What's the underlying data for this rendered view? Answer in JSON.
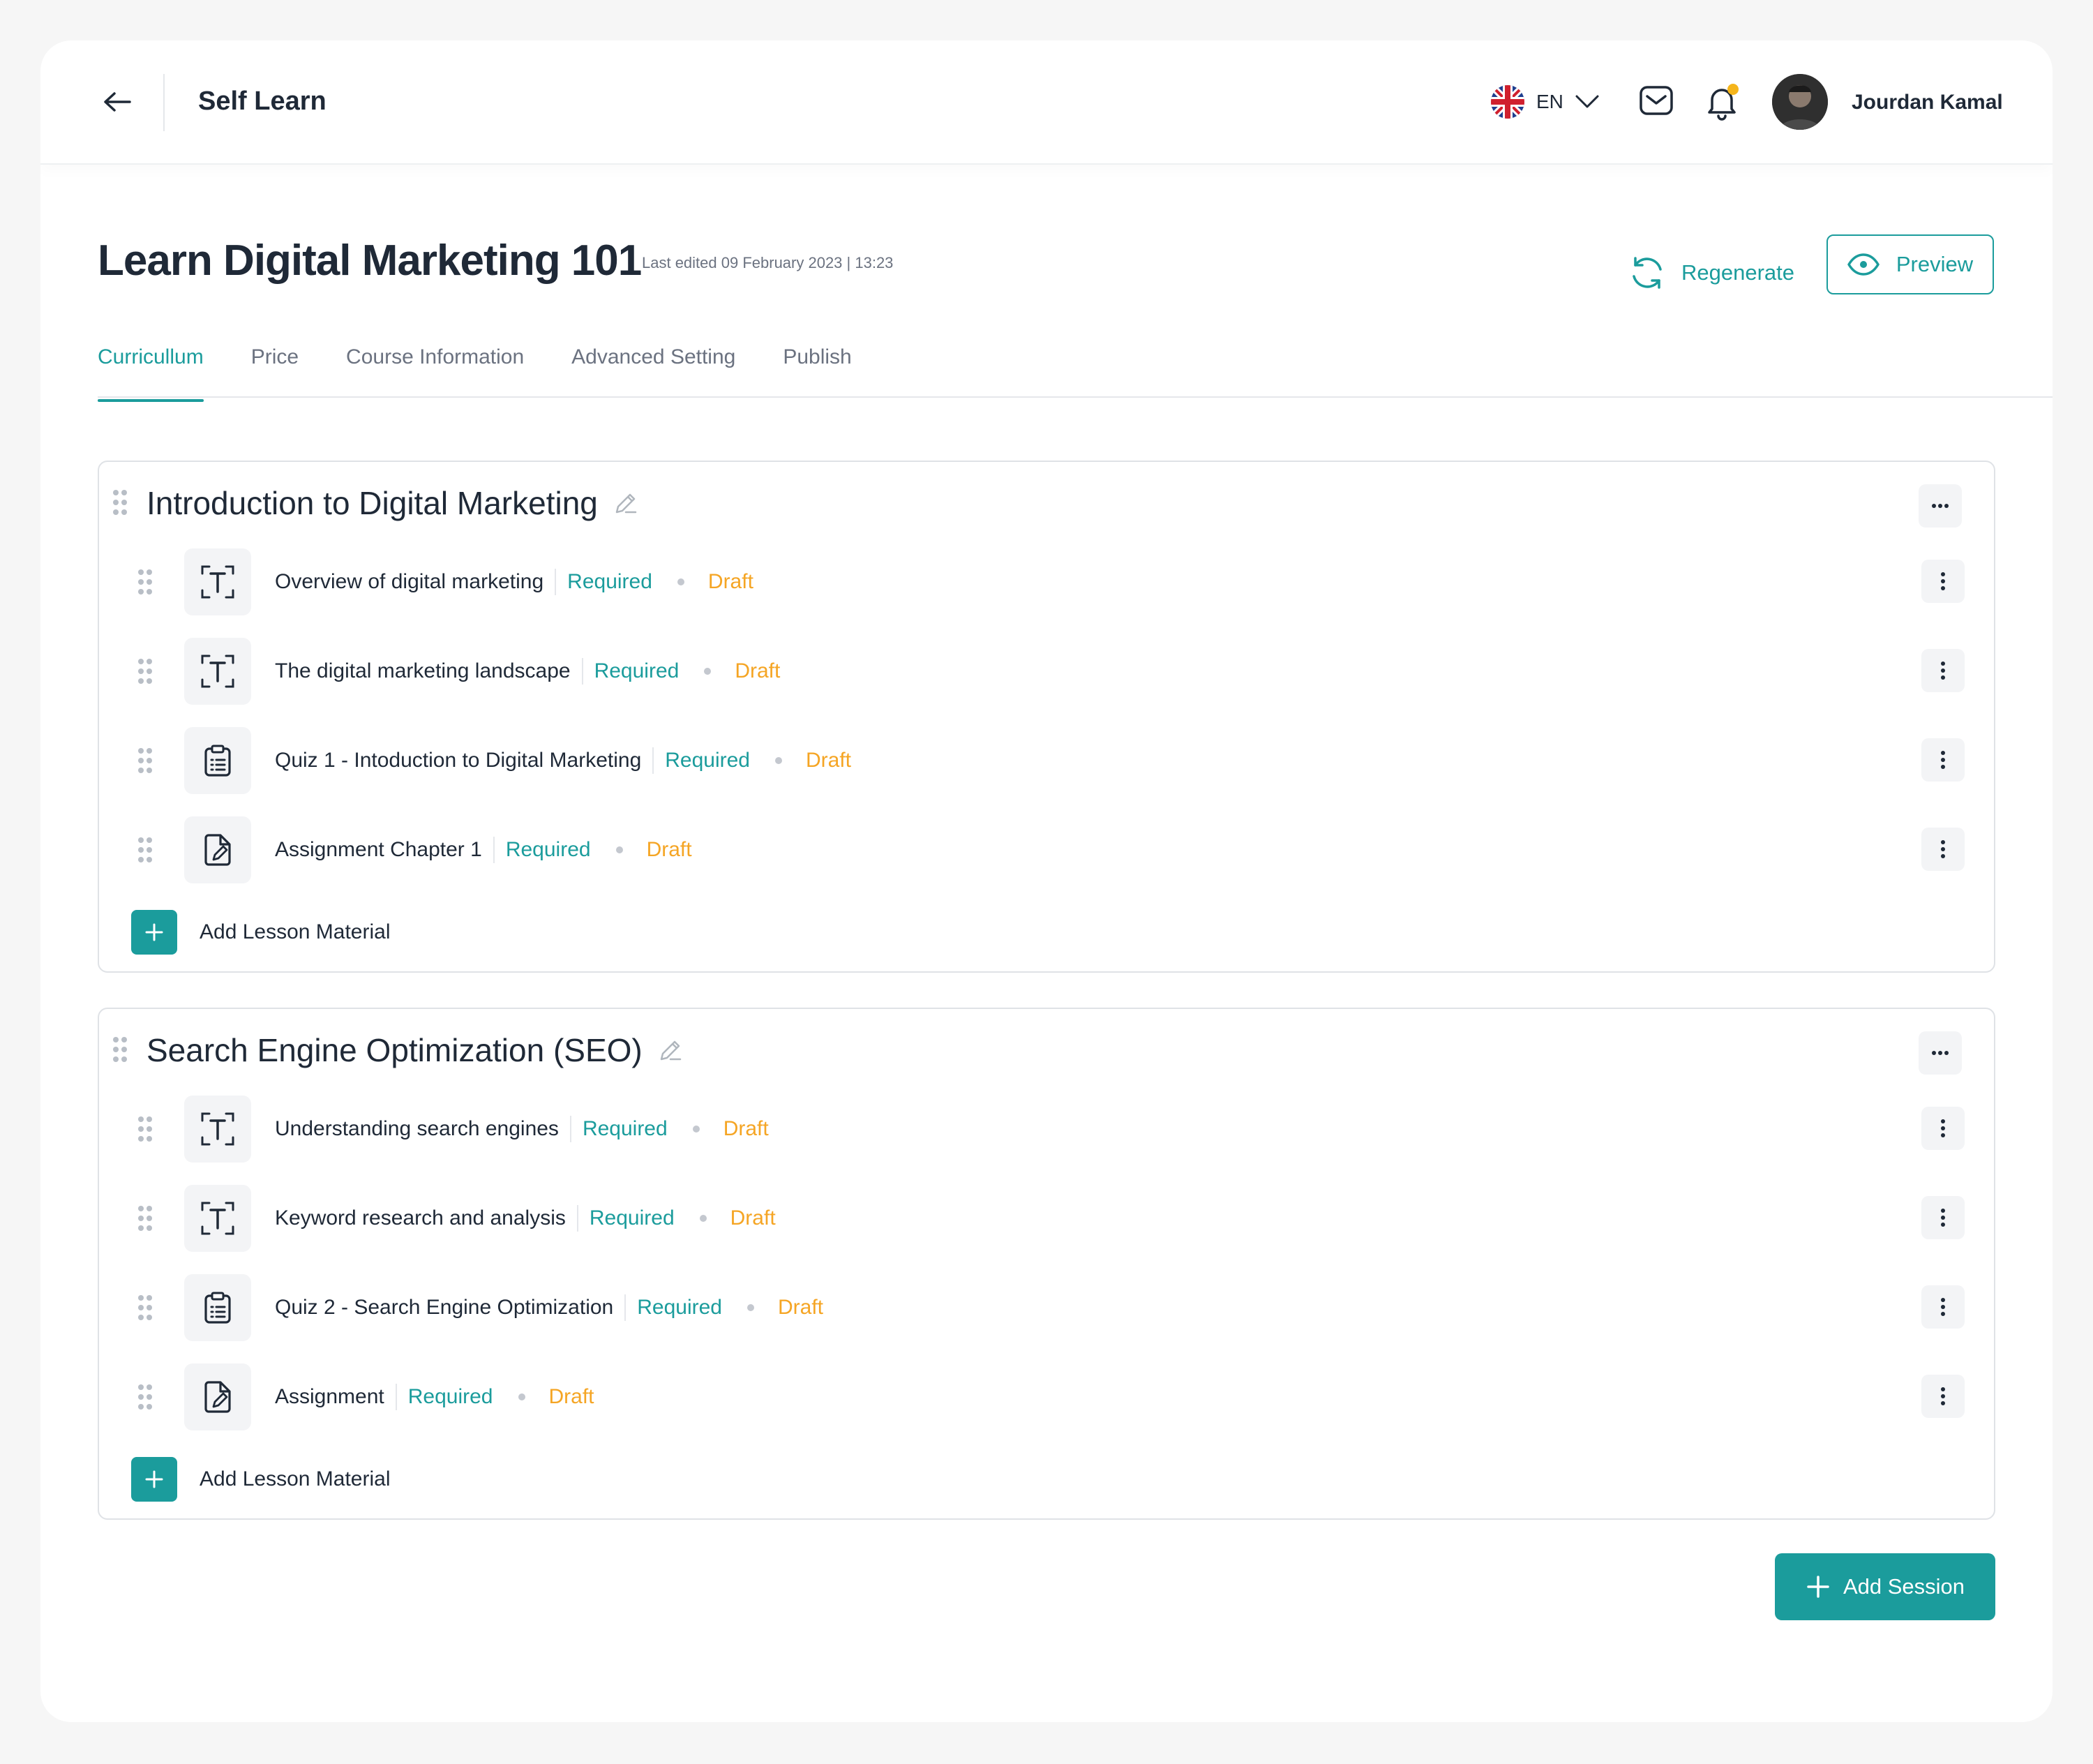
{
  "header": {
    "app_title": "Self Learn",
    "language": {
      "code": "EN",
      "flag": "uk-flag-icon"
    },
    "user": {
      "name": "Jourdan Kamal"
    },
    "notification_dot_color": "#f5b51b"
  },
  "course": {
    "title": "Learn Digital Marketing 101",
    "last_edited": "Last edited 09 February 2023 | 13:23",
    "regenerate_label": "Regenerate",
    "preview_label": "Preview"
  },
  "tabs": [
    {
      "label": "Curricullum",
      "active": true
    },
    {
      "label": "Price",
      "active": false
    },
    {
      "label": "Course Information",
      "active": false
    },
    {
      "label": "Advanced Setting",
      "active": false
    },
    {
      "label": "Publish",
      "active": false
    }
  ],
  "sessions": [
    {
      "title": "Introduction to Digital Marketing",
      "lessons": [
        {
          "name": "Overview of digital marketing",
          "type": "text",
          "requirement": "Required",
          "status": "Draft"
        },
        {
          "name": "The digital marketing landscape",
          "type": "text",
          "requirement": "Required",
          "status": "Draft"
        },
        {
          "name": "Quiz 1 - Intoduction to Digital Marketing",
          "type": "quiz",
          "requirement": "Required",
          "status": "Draft"
        },
        {
          "name": "Assignment Chapter 1",
          "type": "assignment",
          "requirement": "Required",
          "status": "Draft"
        }
      ],
      "add_lesson_label": "Add Lesson Material"
    },
    {
      "title": "Search Engine Optimization (SEO)",
      "lessons": [
        {
          "name": "Understanding search engines",
          "type": "text",
          "requirement": "Required",
          "status": "Draft"
        },
        {
          "name": "Keyword research and analysis",
          "type": "text",
          "requirement": "Required",
          "status": "Draft"
        },
        {
          "name": "Quiz 2 - Search Engine Optimization",
          "type": "quiz",
          "requirement": "Required",
          "status": "Draft"
        },
        {
          "name": "Assignment",
          "type": "assignment",
          "requirement": "Required",
          "status": "Draft"
        }
      ],
      "add_lesson_label": "Add Lesson Material"
    }
  ],
  "add_session_label": "Add Session",
  "colors": {
    "accent": "#1b9c9c",
    "draft": "#f5a524",
    "text": "#1f2937",
    "muted": "#6b7280"
  },
  "icons": {
    "text": "text-lesson-icon",
    "quiz": "quiz-clipboard-icon",
    "assignment": "assignment-document-icon"
  }
}
